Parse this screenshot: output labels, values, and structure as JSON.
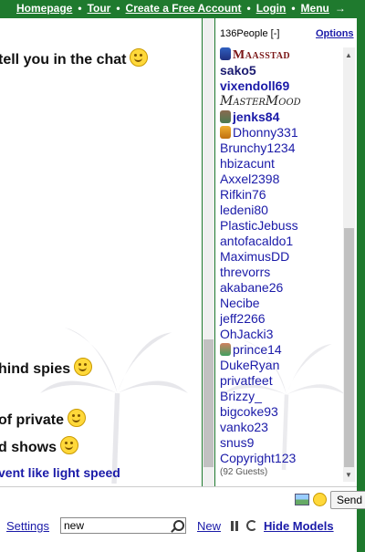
{
  "nav": {
    "items": [
      "Homepage",
      "Tour",
      "Create a Free Account",
      "Login",
      "Menu"
    ],
    "separator": "•",
    "arrow": "→"
  },
  "chat": {
    "messages": [
      {
        "text": "tell you in the chat",
        "smiley": true
      },
      {
        "text": "hind spies",
        "smiley": true
      },
      {
        "text": "of private",
        "smiley": true
      },
      {
        "text": "d shows",
        "smiley": true
      },
      {
        "text": "vent like light speed",
        "smiley": false,
        "color": "blue"
      }
    ]
  },
  "users": {
    "count_label": "136People",
    "toggle": "[-]",
    "options_label": "Options",
    "list": [
      {
        "name": "Maasstad",
        "style": "fancy brown",
        "icon": "blue"
      },
      {
        "name": "sako5",
        "style": "bold dark"
      },
      {
        "name": "vixendoll69",
        "style": "bold"
      },
      {
        "name": "MasterMood",
        "style": "script"
      },
      {
        "name": "jenks84",
        "style": "bold",
        "icon": "photo"
      },
      {
        "name": "Dhonny331",
        "style": "",
        "icon": "gold"
      },
      {
        "name": "Brunchy1234",
        "style": ""
      },
      {
        "name": "hbizacunt",
        "style": ""
      },
      {
        "name": "Axxel2398",
        "style": ""
      },
      {
        "name": "Rifkin76",
        "style": ""
      },
      {
        "name": "ledeni80",
        "style": ""
      },
      {
        "name": "PlasticJebuss",
        "style": ""
      },
      {
        "name": "antofacaldo1",
        "style": ""
      },
      {
        "name": "MaximusDD",
        "style": ""
      },
      {
        "name": "threvorrs",
        "style": ""
      },
      {
        "name": "akabane26",
        "style": ""
      },
      {
        "name": "Necibe",
        "style": ""
      },
      {
        "name": "jeff2266",
        "style": ""
      },
      {
        "name": "OhJacki3",
        "style": ""
      },
      {
        "name": "prince14",
        "style": "",
        "icon": "green"
      },
      {
        "name": "DukeRyan",
        "style": ""
      },
      {
        "name": "privatfeet",
        "style": ""
      },
      {
        "name": "Brizzy_",
        "style": ""
      },
      {
        "name": "bigcoke93",
        "style": ""
      },
      {
        "name": "vanko23",
        "style": ""
      },
      {
        "name": "snus9",
        "style": ""
      },
      {
        "name": "Copyright123",
        "style": ""
      }
    ],
    "guests": "(92 Guests)"
  },
  "bottom": {
    "send_label": "Send",
    "settings_label": "Settings",
    "search_value": "new",
    "new_label": "New",
    "hide_models_label": "Hide Models"
  },
  "icons": {
    "image": "image-icon",
    "emoticon": "smiley-icon",
    "search": "search-icon",
    "pause": "pause-icon",
    "refresh": "refresh-icon"
  }
}
